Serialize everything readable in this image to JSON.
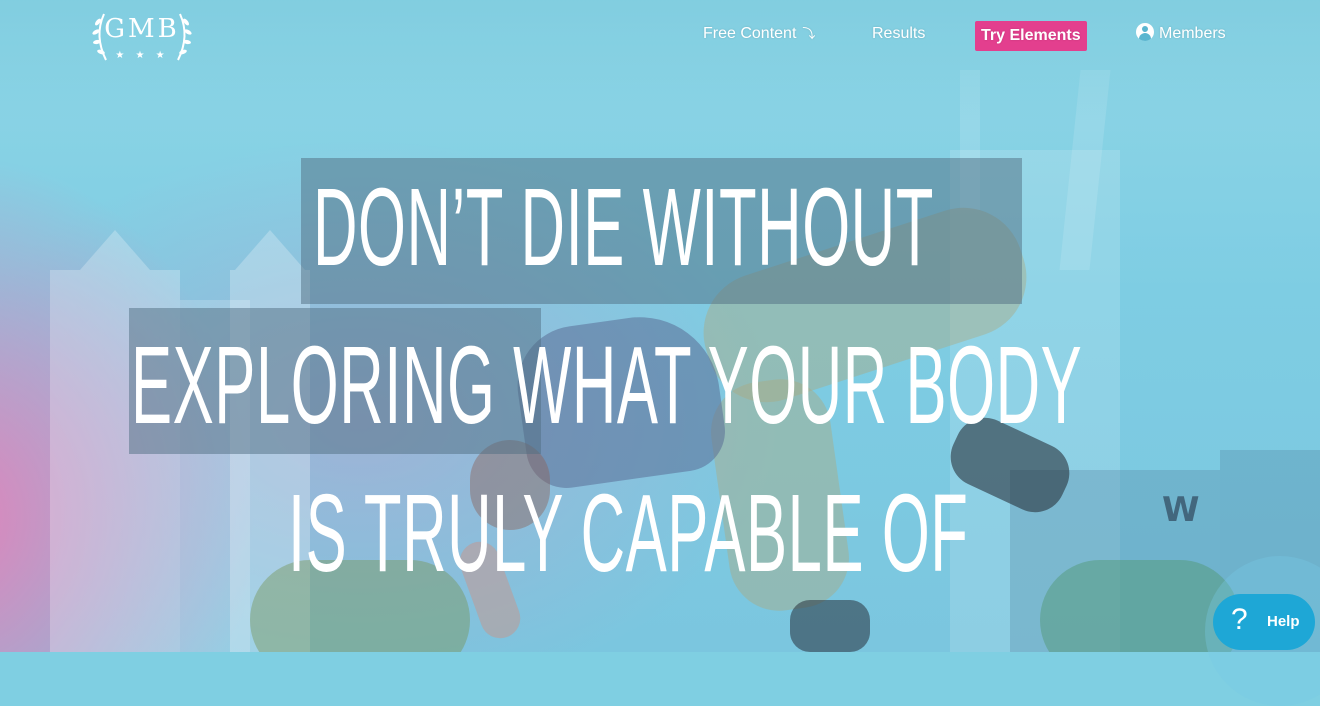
{
  "header": {
    "logo": {
      "text": "GMB",
      "stars": "★ ★ ★"
    },
    "nav": {
      "free_content": "Free Content",
      "free_content_arrow": "⤵",
      "results": "Results",
      "try_elements": "Try Elements",
      "members": "Members"
    }
  },
  "hero": {
    "line1": "DON’T DIE WITHOUT",
    "line2": "EXPLORING WHAT YOUR BODY",
    "line3": "IS TRULY CAPABLE OF",
    "background_sign": "W"
  },
  "help": {
    "icon": "?",
    "label": "Help"
  },
  "colors": {
    "accent_pink": "#e33f8e",
    "help_blue": "#1ea7d6"
  }
}
